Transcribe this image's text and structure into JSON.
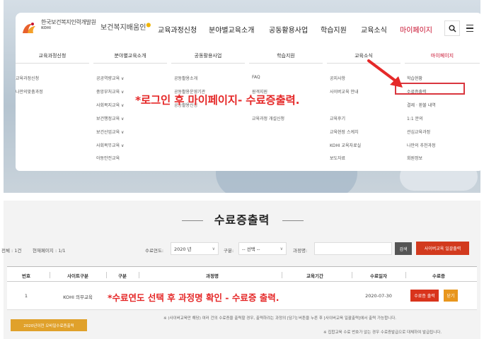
{
  "colors": {
    "accent": "#c8102e",
    "annotation": "#e52929",
    "print_button": "#d9341c",
    "close_button": "#e8961d"
  },
  "header": {
    "logo_kr": "한국보건복지인력개발원",
    "logo_en": "KOHI",
    "logo_sub": "보건복지배움인",
    "nav": [
      "교육과정신청",
      "분야별교육소개",
      "공동활용사업",
      "학습지원",
      "교육소식",
      "마이페이지"
    ],
    "search_icon": "search-icon",
    "menu_icon": "hamburger-icon"
  },
  "mega_menu": {
    "columns": [
      {
        "title": "교육과정신청",
        "items": [
          "교육과정신청",
          "나만의맞춤과정"
        ]
      },
      {
        "title": "분야별교육소개",
        "items": [
          "공공역량교육 ∨",
          "중앙부처교육 ∨",
          "사회복지교육 ∨",
          "보건행정교육 ∨",
          "보건산업교육 ∨",
          "사회복무교육 ∨",
          "아동안전교육"
        ]
      },
      {
        "title": "공동활용사업",
        "items": [
          "공동활용소개",
          "공동활용운영기관",
          "공동활용신청"
        ]
      },
      {
        "title": "학습지원",
        "items": [
          "FAQ",
          "원격지원",
          "",
          "교육과정 개설신청"
        ]
      },
      {
        "title": "교육소식",
        "items": [
          "공지사항",
          "사이버교육 안내",
          "",
          "교육후기",
          "교육현장 스케치",
          "KOHI 교육자료실",
          "보도자료"
        ]
      },
      {
        "title": "마이페이지",
        "items": [
          "학습현황",
          "수료증출력",
          "결제 · 환불 내역",
          "1:1 문의",
          "관심교육과정",
          "나만의 추천과정",
          "회원정보"
        ]
      }
    ]
  },
  "annotation_top": "*로그인 후 마이페이지- 수료증출력.",
  "cert_page": {
    "title": "수료증출력",
    "total_label": "전체 : 1건",
    "page_label": "현재페이지 : 1/1",
    "year_label": "수료연도:",
    "year_value": "2020 년",
    "type_label": "구분:",
    "type_value": "-- 선택 --",
    "course_label": "과정명:",
    "search_button": "검색",
    "cyber_button": "사이버교육 일괄출력",
    "table": {
      "headers": [
        "번호",
        "사이트구분",
        "구분",
        "과정명",
        "교육기간",
        "수료일자",
        "수료증"
      ],
      "rows": [
        {
          "no": "1",
          "site": "KOHI 의무교육",
          "date": "2020-07-30"
        }
      ],
      "print_button": "수료증 출력",
      "close_button": "닫기"
    },
    "annotation_bottom": "*수료연도 선택 후 과정명 확인 - 수료증 출력.",
    "exam_button": "2020년이전 오바일수료증출력",
    "note1": "※ (사이버교육만 해당) 여러 건의 수료증을 출력할 경우, 출력하려는 과정의 [담기] 버튼을 누른 후 [사이버교육 일괄출력]에서 출력 가능합니다.",
    "note2": "※ 집합교육 수료 번호가 없는 경우 수료증발급으로 대체하여 발급됩니다."
  }
}
